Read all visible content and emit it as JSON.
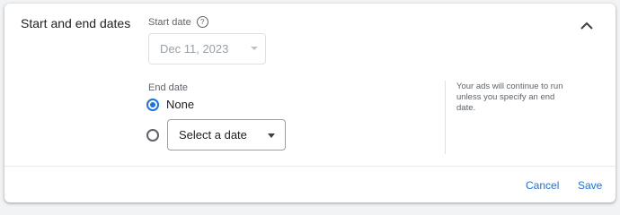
{
  "section": {
    "title": "Start and end dates"
  },
  "start_date": {
    "label": "Start date",
    "value": "Dec 11, 2023",
    "help_icon": "help-circle-icon"
  },
  "end_date": {
    "label": "End date",
    "options": {
      "none_label": "None",
      "select_placeholder": "Select a date"
    },
    "selected": "None"
  },
  "helper_text": "Your ads will continue to run unless you specify an end date.",
  "footer": {
    "cancel_label": "Cancel",
    "save_label": "Save"
  },
  "colors": {
    "accent": "#1a73e8",
    "muted": "#5f6368",
    "disabled": "#9aa0a6"
  }
}
